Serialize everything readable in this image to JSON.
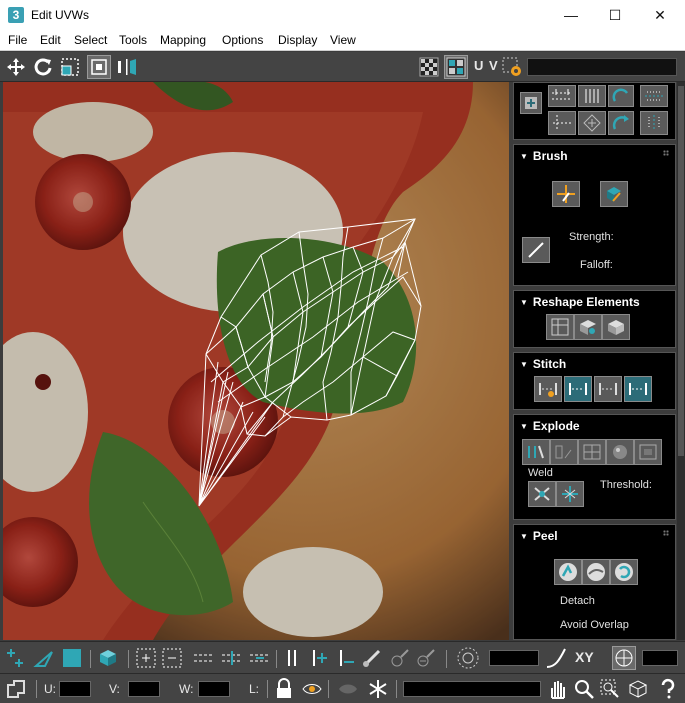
{
  "window": {
    "title": "Edit UVWs",
    "app_icon": "3",
    "minimize": "—",
    "maximize": "☐",
    "close": "✕"
  },
  "menu": [
    "File",
    "Edit",
    "Select",
    "Tools",
    "Mapping",
    "Options",
    "Display",
    "View"
  ],
  "toolbar": {
    "uv_label": "U V",
    "texture_dropdown_value": ""
  },
  "viewport": {
    "background_image": "pizza-margherita-texture",
    "mesh": "uv-wireframe-basil-leaf"
  },
  "panels": {
    "brush": {
      "title": "Brush",
      "strength_label": "Strength:",
      "falloff_label": "Falloff:"
    },
    "reshape": {
      "title": "Reshape Elements"
    },
    "stitch": {
      "title": "Stitch"
    },
    "explode": {
      "title": "Explode",
      "weld_label": "Weld",
      "threshold_label": "Threshold:"
    },
    "peel": {
      "title": "Peel",
      "detach_label": "Detach",
      "avoid_overlap_label": "Avoid Overlap"
    }
  },
  "bottom": {
    "xy_label": "XY",
    "u_label": "U:",
    "v_label": "V:",
    "w_label": "W:",
    "l_label": "L:",
    "u_value": "",
    "v_value": "",
    "w_value": "",
    "angle_value": "",
    "spacing_value": "",
    "scale_value": ""
  },
  "colors": {
    "ui_dark": "#444444",
    "panel_black": "#000000",
    "wire": "#ffffff",
    "accent_teal": "#2fa7b5"
  }
}
